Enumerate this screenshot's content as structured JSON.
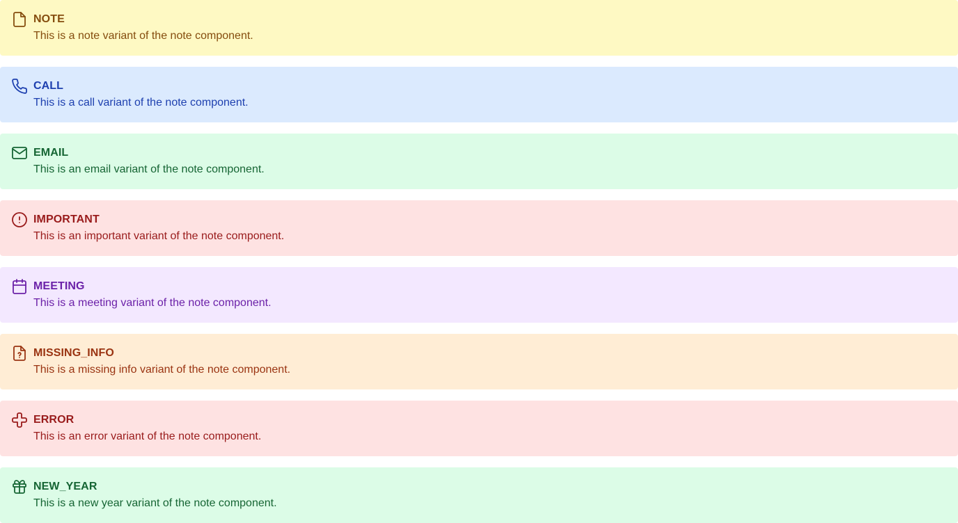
{
  "notes": [
    {
      "variant": "note",
      "icon": "file-icon",
      "title": "NOTE",
      "text": "This is a note variant of the note component.",
      "background": "#fef9c3",
      "color": "#854d0e"
    },
    {
      "variant": "call",
      "icon": "phone-icon",
      "title": "CALL",
      "text": "This is a call variant of the note component.",
      "background": "#dbeafe",
      "color": "#1e40af"
    },
    {
      "variant": "email",
      "icon": "mail-icon",
      "title": "EMAIL",
      "text": "This is an email variant of the note component.",
      "background": "#dcfce7",
      "color": "#166534"
    },
    {
      "variant": "important",
      "icon": "alert-circle-icon",
      "title": "IMPORTANT",
      "text": "This is an important variant of the note component.",
      "background": "#fee2e2",
      "color": "#991b1b"
    },
    {
      "variant": "meeting",
      "icon": "calendar-icon",
      "title": "MEETING",
      "text": "This is a meeting variant of the note component.",
      "background": "#f3e8ff",
      "color": "#6b21a8"
    },
    {
      "variant": "missing_info",
      "icon": "file-question-icon",
      "title": "MISSING_INFO",
      "text": "This is a missing info variant of the note component.",
      "background": "#ffedd5",
      "color": "#9a3412"
    },
    {
      "variant": "error",
      "icon": "cross-icon",
      "title": "ERROR",
      "text": "This is an error variant of the note component.",
      "background": "#fee2e2",
      "color": "#991b1b"
    },
    {
      "variant": "new_year",
      "icon": "gift-icon",
      "title": "NEW_YEAR",
      "text": "This is a new year variant of the note component.",
      "background": "#dcfce7",
      "color": "#166534"
    }
  ]
}
